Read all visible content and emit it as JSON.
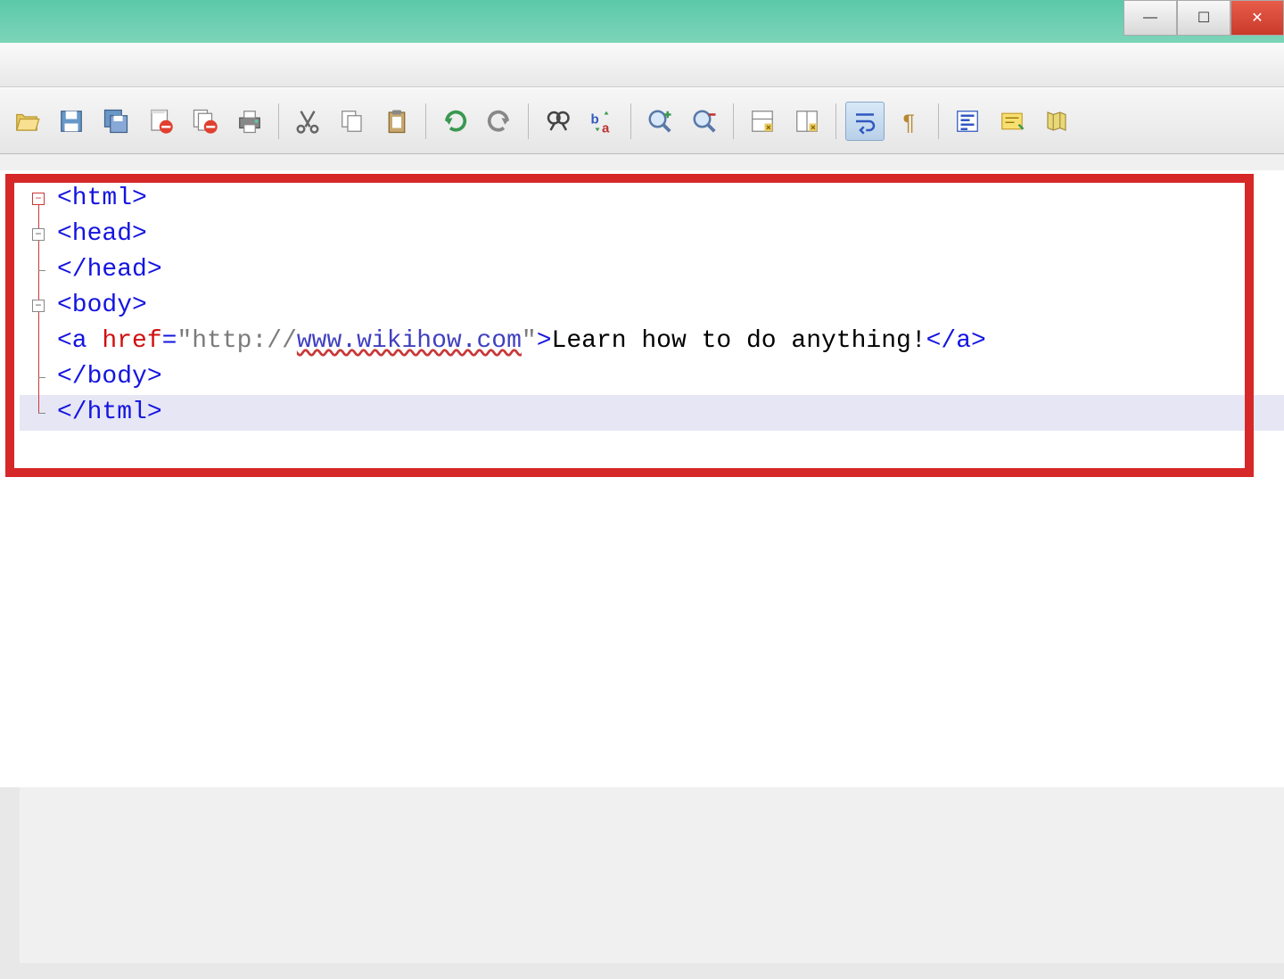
{
  "window": {
    "minimize": "—",
    "maximize": "☐",
    "close": "✕"
  },
  "toolbar": {
    "items": [
      {
        "name": "open-file-icon",
        "type": "icon"
      },
      {
        "name": "save-icon",
        "type": "icon"
      },
      {
        "name": "save-all-icon",
        "type": "icon"
      },
      {
        "name": "close-file-icon",
        "type": "icon"
      },
      {
        "name": "close-all-icon",
        "type": "icon"
      },
      {
        "name": "print-icon",
        "type": "icon"
      },
      {
        "type": "sep"
      },
      {
        "name": "cut-icon",
        "type": "icon"
      },
      {
        "name": "copy-icon",
        "type": "icon"
      },
      {
        "name": "paste-icon",
        "type": "icon"
      },
      {
        "type": "sep"
      },
      {
        "name": "undo-icon",
        "type": "icon"
      },
      {
        "name": "redo-icon",
        "type": "icon"
      },
      {
        "type": "sep"
      },
      {
        "name": "find-icon",
        "type": "icon"
      },
      {
        "name": "replace-icon",
        "type": "icon"
      },
      {
        "type": "sep"
      },
      {
        "name": "zoom-in-icon",
        "type": "icon"
      },
      {
        "name": "zoom-out-icon",
        "type": "icon"
      },
      {
        "type": "sep"
      },
      {
        "name": "sync-vertical-icon",
        "type": "icon"
      },
      {
        "name": "sync-horizontal-icon",
        "type": "icon"
      },
      {
        "type": "sep"
      },
      {
        "name": "word-wrap-icon",
        "type": "icon",
        "active": true
      },
      {
        "name": "show-symbols-icon",
        "type": "icon"
      },
      {
        "type": "sep"
      },
      {
        "name": "indent-guide-icon",
        "type": "icon"
      },
      {
        "name": "user-lang-icon",
        "type": "icon"
      },
      {
        "name": "doc-map-icon",
        "type": "icon"
      }
    ]
  },
  "code": {
    "lines": [
      {
        "fold": "minus-red",
        "tokens": [
          {
            "t": "tag",
            "v": "<html>"
          }
        ]
      },
      {
        "fold": "minus",
        "tokens": [
          {
            "t": "tag",
            "v": "<head>"
          }
        ]
      },
      {
        "fold": "tee",
        "tokens": [
          {
            "t": "tag",
            "v": "</head>"
          }
        ]
      },
      {
        "fold": "minus",
        "tokens": [
          {
            "t": "tag",
            "v": "<body>"
          }
        ]
      },
      {
        "fold": "none",
        "tokens": [
          {
            "t": "tag",
            "v": "<a "
          },
          {
            "t": "attr",
            "v": "href"
          },
          {
            "t": "tag",
            "v": "="
          },
          {
            "t": "str",
            "v": "\"http://"
          },
          {
            "t": "url",
            "v": "www.wikihow.com"
          },
          {
            "t": "str",
            "v": "\""
          },
          {
            "t": "tag",
            "v": ">"
          },
          {
            "t": "txt",
            "v": "Learn how to do anything!"
          },
          {
            "t": "tag",
            "v": "</a>"
          }
        ]
      },
      {
        "fold": "tee",
        "tokens": [
          {
            "t": "tag",
            "v": "</body>"
          }
        ]
      },
      {
        "fold": "end",
        "current": true,
        "tokens": [
          {
            "t": "tag",
            "v": "</html>"
          }
        ]
      }
    ]
  }
}
